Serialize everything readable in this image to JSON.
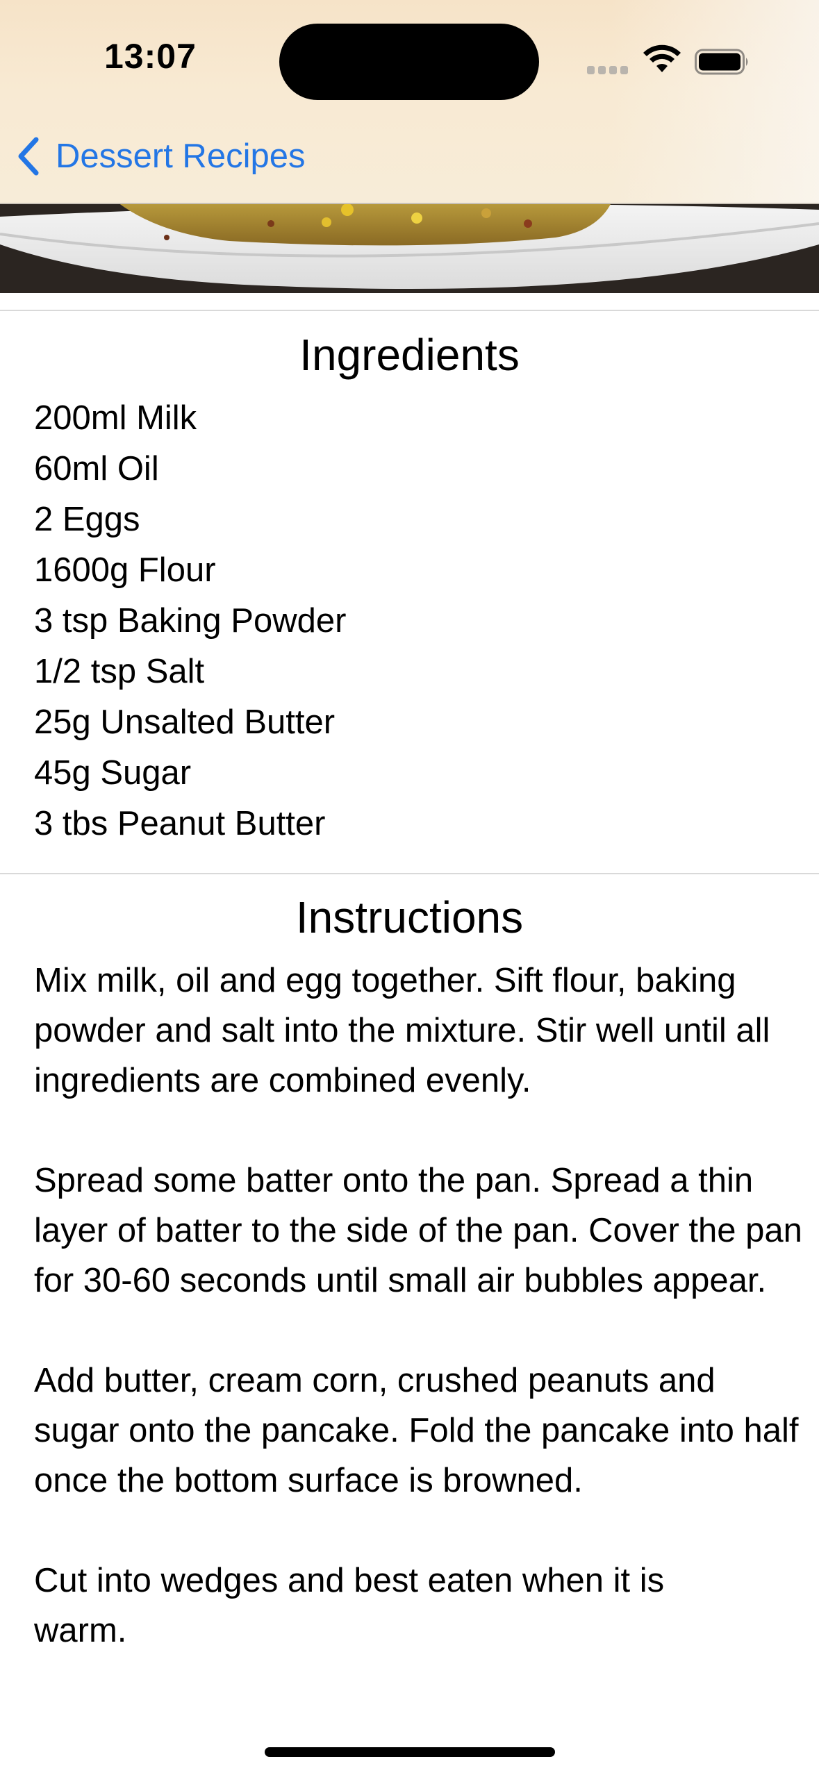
{
  "status_bar": {
    "time": "13:07"
  },
  "nav": {
    "back_label": "Dessert Recipes",
    "back_icon": "chevron-left-icon",
    "accent_color": "#2376e5"
  },
  "ingredients": {
    "title": "Ingredients",
    "items": [
      "200ml Milk",
      "60ml Oil",
      "2 Eggs",
      "1600g Flour",
      "3 tsp Baking Powder",
      "1/2 tsp Salt",
      "25g Unsalted Butter",
      "45g Sugar",
      "3 tbs Peanut Butter"
    ]
  },
  "instructions": {
    "title": "Instructions",
    "paragraphs": [
      "Mix milk, oil and egg together. Sift flour, baking powder and salt into the mixture. Stir well until all ingredients are combined evenly.",
      "Spread some batter onto the pan. Spread a thin layer of batter to the side of the pan. Cover the pan for 30-60 seconds until small air bubbles appear.",
      "Add butter, cream corn, crushed peanuts and sugar onto the pancake. Fold the pancake into half once the bottom surface is browned.",
      "Cut into wedges and best eaten when it is warm."
    ]
  }
}
